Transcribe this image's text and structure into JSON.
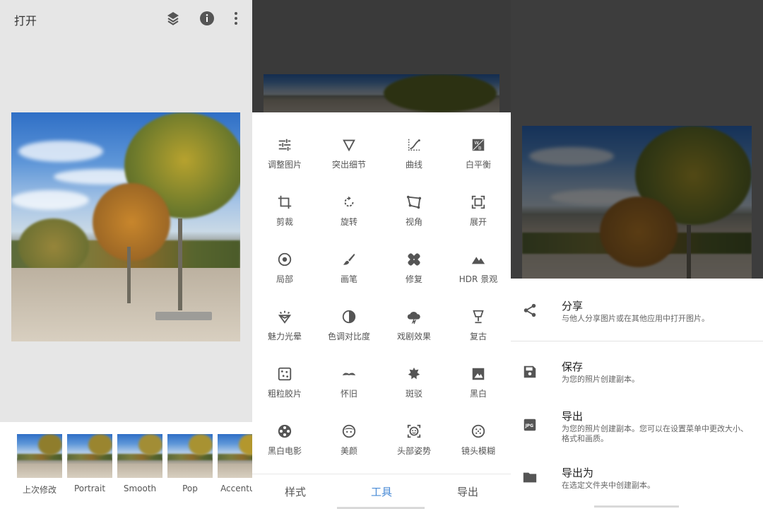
{
  "panel1": {
    "open_label": "打开",
    "icons": [
      "layers-icon",
      "info-icon",
      "more-vert-icon"
    ],
    "looks": [
      {
        "label": "上次修改"
      },
      {
        "label": "Portrait"
      },
      {
        "label": "Smooth"
      },
      {
        "label": "Pop"
      },
      {
        "label": "Accentua"
      }
    ]
  },
  "panel2": {
    "tools": [
      {
        "label": "调整图片",
        "icon": "tune-icon"
      },
      {
        "label": "突出细节",
        "icon": "details-icon"
      },
      {
        "label": "曲线",
        "icon": "curves-icon"
      },
      {
        "label": "白平衡",
        "icon": "white-balance-icon"
      },
      {
        "label": "剪裁",
        "icon": "crop-icon"
      },
      {
        "label": "旋转",
        "icon": "rotate-icon"
      },
      {
        "label": "视角",
        "icon": "perspective-icon"
      },
      {
        "label": "展开",
        "icon": "expand-icon"
      },
      {
        "label": "局部",
        "icon": "selective-icon"
      },
      {
        "label": "画笔",
        "icon": "brush-icon"
      },
      {
        "label": "修复",
        "icon": "healing-icon"
      },
      {
        "label": "HDR 景观",
        "icon": "hdr-icon"
      },
      {
        "label": "魅力光晕",
        "icon": "glamour-glow-icon"
      },
      {
        "label": "色调对比度",
        "icon": "tonal-contrast-icon"
      },
      {
        "label": "戏剧效果",
        "icon": "drama-icon"
      },
      {
        "label": "复古",
        "icon": "vintage-icon"
      },
      {
        "label": "粗粒胶片",
        "icon": "grainy-film-icon"
      },
      {
        "label": "怀旧",
        "icon": "retrolux-icon"
      },
      {
        "label": "斑驳",
        "icon": "grunge-icon"
      },
      {
        "label": "黑白",
        "icon": "black-white-icon"
      },
      {
        "label": "黑白电影",
        "icon": "noir-icon"
      },
      {
        "label": "美颜",
        "icon": "face-icon"
      },
      {
        "label": "头部姿势",
        "icon": "head-pose-icon"
      },
      {
        "label": "镜头模糊",
        "icon": "lens-blur-icon"
      }
    ],
    "tabs": [
      "样式",
      "工具",
      "导出"
    ],
    "active_tab": "工具"
  },
  "panel3": {
    "menu": [
      {
        "title": "分享",
        "desc": "与他人分享图片或在其他应用中打开图片。",
        "icon": "share-icon"
      },
      {
        "title": "保存",
        "desc": "为您的照片创建副本。",
        "icon": "save-icon"
      },
      {
        "title": "导出",
        "desc": "为您的照片创建副本。您可以在设置菜单中更改大小、格式和画质。",
        "icon": "jpg-icon"
      },
      {
        "title": "导出为",
        "desc": "在选定文件夹中创建副本。",
        "icon": "folder-icon"
      }
    ]
  },
  "colors": {
    "accent": "#4a8bd6",
    "icon": "#555555"
  }
}
